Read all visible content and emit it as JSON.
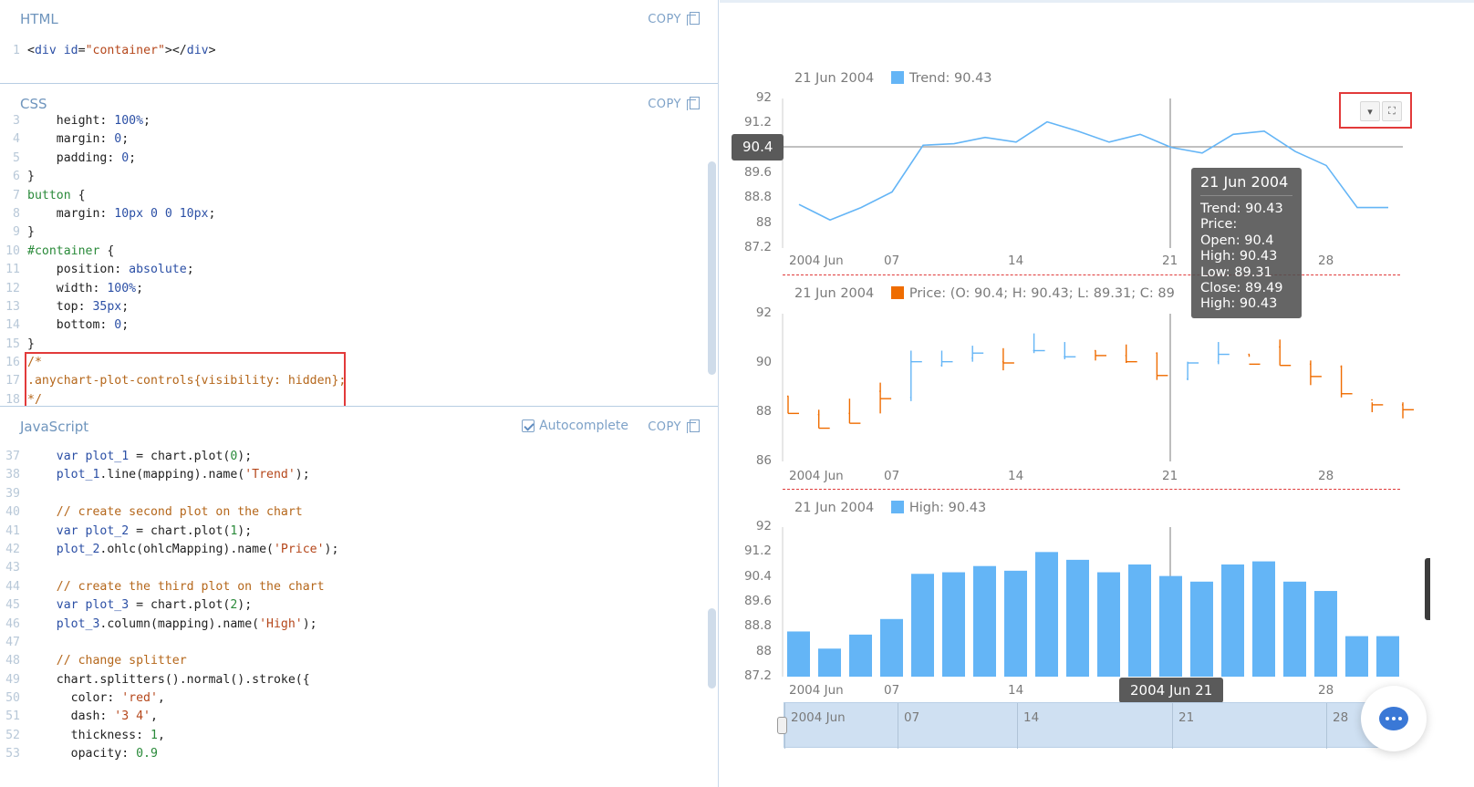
{
  "editor": {
    "html": {
      "title": "HTML",
      "copy_label": "COPY",
      "lines": [
        {
          "n": "1",
          "code": "<div id=\"container\"></div>"
        }
      ]
    },
    "css": {
      "title": "CSS",
      "copy_label": "COPY",
      "lines": [
        {
          "n": "3",
          "code": "    height: 100%;"
        },
        {
          "n": "4",
          "code": "    margin: 0;"
        },
        {
          "n": "5",
          "code": "    padding: 0;"
        },
        {
          "n": "6",
          "code": "}"
        },
        {
          "n": "7",
          "code": "button {"
        },
        {
          "n": "8",
          "code": "    margin: 10px 0 0 10px;"
        },
        {
          "n": "9",
          "code": "}"
        },
        {
          "n": "10",
          "code": "#container {"
        },
        {
          "n": "11",
          "code": "    position: absolute;"
        },
        {
          "n": "12",
          "code": "    width: 100%;"
        },
        {
          "n": "13",
          "code": "    top: 35px;"
        },
        {
          "n": "14",
          "code": "    bottom: 0;"
        },
        {
          "n": "15",
          "code": "}"
        },
        {
          "n": "16",
          "code": "/*"
        },
        {
          "n": "17",
          "code": ".anychart-plot-controls{visibility: hidden};"
        },
        {
          "n": "18",
          "code": "*/"
        }
      ]
    },
    "js": {
      "title": "JavaScript",
      "autocomplete_label": "Autocomplete",
      "copy_label": "COPY",
      "lines": [
        {
          "n": "37",
          "code": "    var plot_1 = chart.plot(0);"
        },
        {
          "n": "38",
          "code": "    plot_1.line(mapping).name('Trend');"
        },
        {
          "n": "39",
          "code": ""
        },
        {
          "n": "40",
          "code": "    // create second plot on the chart"
        },
        {
          "n": "41",
          "code": "    var plot_2 = chart.plot(1);"
        },
        {
          "n": "42",
          "code": "    plot_2.ohlc(ohlcMapping).name('Price');"
        },
        {
          "n": "43",
          "code": ""
        },
        {
          "n": "44",
          "code": "    // create the third plot on the chart"
        },
        {
          "n": "45",
          "code": "    var plot_3 = chart.plot(2);"
        },
        {
          "n": "46",
          "code": "    plot_3.column(mapping).name('High');"
        },
        {
          "n": "47",
          "code": ""
        },
        {
          "n": "48",
          "code": "    // change splitter"
        },
        {
          "n": "49",
          "code": "    chart.splitters().normal().stroke({"
        },
        {
          "n": "50",
          "code": "      color: 'red',"
        },
        {
          "n": "51",
          "code": "      dash: '3 4',"
        },
        {
          "n": "52",
          "code": "      thickness: 1,"
        },
        {
          "n": "53",
          "code": "      opacity: 0.9"
        }
      ]
    }
  },
  "chart": {
    "colors": {
      "trend": "#64b5f6",
      "price_up": "#64b5f6",
      "price_down": "#ef6c00",
      "high": "#64b5f6",
      "splitter": "#e03b3b"
    },
    "plot1": {
      "date_label": "21 Jun 2004",
      "legend": "Trend: 90.43",
      "yticks": [
        "92",
        "91.2",
        "90.4",
        "89.6",
        "88.8",
        "88",
        "87.2"
      ],
      "crosshair_y_label": "90.4"
    },
    "plot2": {
      "date_label": "21 Jun 2004",
      "legend": "Price: (O: 90.4; H: 90.43; L: 89.31; C: 89",
      "yticks": [
        "92",
        "90",
        "88",
        "86"
      ]
    },
    "plot3": {
      "date_label": "21 Jun 2004",
      "legend": "High: 90.43",
      "yticks": [
        "92",
        "91.2",
        "90.4",
        "89.6",
        "88.8",
        "88",
        "87.2"
      ]
    },
    "xticks": [
      "2004 Jun",
      "07",
      "14",
      "21",
      "28"
    ],
    "crosshair_x_label": "2004 Jun 21",
    "scroller_labels": [
      "2004 Jun",
      "07",
      "14",
      "21",
      "28"
    ],
    "tooltip": {
      "title": "21 Jun 2004",
      "rows": [
        "Trend: 90.43",
        "Price:",
        "Open: 90.4",
        "High: 90.43",
        "Low: 89.31",
        "Close: 89.49",
        "High: 90.43"
      ]
    },
    "controls": {
      "menu_icon": "chevron-down-icon",
      "fullscreen_icon": "expand-icon"
    }
  },
  "chart_data": [
    {
      "type": "line",
      "series": [
        {
          "name": "Trend",
          "values": [
            88.6,
            88.1,
            88.5,
            89.0,
            90.5,
            90.55,
            90.75,
            90.6,
            91.25,
            90.95,
            90.6,
            90.85,
            90.43,
            90.25,
            90.85,
            90.95,
            90.3,
            89.85,
            88.5,
            88.5
          ]
        }
      ],
      "ylim": [
        87.2,
        92
      ]
    },
    {
      "type": "table",
      "series": [
        {
          "name": "Price",
          "open": [
            88.65,
            87.9,
            87.95,
            88.85,
            88.6,
            89.9,
            90.2,
            90.05,
            90.5,
            90.25,
            90.5,
            90.3,
            90.4,
            89.35,
            90.05,
            90.35,
            90.65,
            89.95,
            89.85,
            88.5,
            88.3
          ],
          "high": [
            88.65,
            88.1,
            88.55,
            89.2,
            90.5,
            90.5,
            90.7,
            90.6,
            91.2,
            90.85,
            90.5,
            90.75,
            90.43,
            90.05,
            90.85,
            90.35,
            90.95,
            90.1,
            89.9,
            88.4,
            88.4
          ],
          "low": [
            87.95,
            87.35,
            87.55,
            87.95,
            88.45,
            89.85,
            90.05,
            89.7,
            90.4,
            90.15,
            90.1,
            90.0,
            89.31,
            89.3,
            89.95,
            90.25,
            89.9,
            89.1,
            88.6,
            88.0,
            87.75
          ],
          "close": [
            87.95,
            87.35,
            87.55,
            88.55,
            90.05,
            90.05,
            90.4,
            90.0,
            90.5,
            90.25,
            90.3,
            90.05,
            89.49,
            90.0,
            90.35,
            89.95,
            89.9,
            89.45,
            88.75,
            88.3,
            88.1
          ]
        }
      ],
      "ylim": [
        86,
        92
      ]
    },
    {
      "type": "bar",
      "series": [
        {
          "name": "High",
          "values": [
            88.65,
            88.1,
            88.55,
            89.05,
            90.5,
            90.55,
            90.75,
            90.6,
            91.2,
            90.95,
            90.55,
            90.8,
            90.43,
            90.25,
            90.8,
            90.9,
            90.25,
            89.95,
            88.5,
            88.5
          ]
        }
      ],
      "ylim": [
        87.2,
        92
      ]
    }
  ]
}
